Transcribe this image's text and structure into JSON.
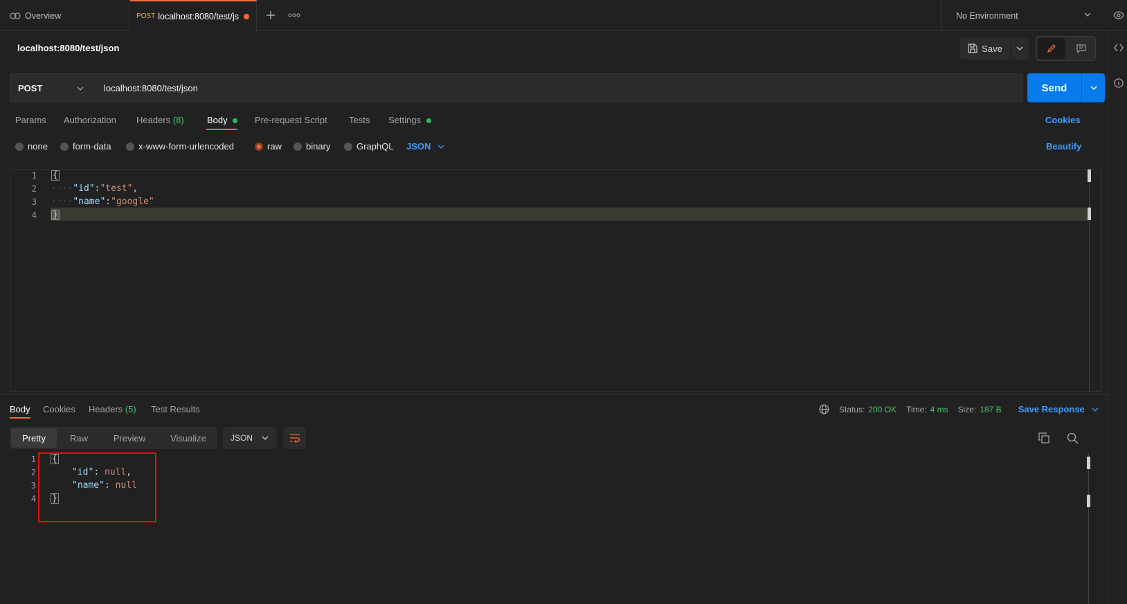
{
  "tabs": {
    "overview_label": "Overview",
    "active_method": "POST",
    "active_label": "localhost:8080/test/js",
    "environment": "No Environment"
  },
  "request": {
    "title": "localhost:8080/test/json",
    "save_label": "Save",
    "method": "POST",
    "url": "localhost:8080/test/json",
    "send_label": "Send"
  },
  "request_tabs": {
    "params": "Params",
    "authorization": "Authorization",
    "headers": "Headers",
    "headers_count": "(8)",
    "body": "Body",
    "pre_request": "Pre-request Script",
    "tests": "Tests",
    "settings": "Settings",
    "cookies": "Cookies"
  },
  "body_options": {
    "none": "none",
    "form_data": "form-data",
    "urlencoded": "x-www-form-urlencoded",
    "raw": "raw",
    "binary": "binary",
    "graphql": "GraphQL",
    "format": "JSON",
    "beautify": "Beautify"
  },
  "request_body": {
    "line_numbers": [
      "1",
      "2",
      "3",
      "4"
    ],
    "open_brace": "{",
    "close_brace": "}",
    "line2_indent": "····",
    "line2_key": "\"id\"",
    "line2_colon": ":",
    "line2_value": "\"test\"",
    "line2_comma": ",",
    "line3_indent": "····",
    "line3_key": "\"name\"",
    "line3_colon": ":",
    "line3_value": "\"google\""
  },
  "response_tabs": {
    "body": "Body",
    "cookies": "Cookies",
    "headers": "Headers",
    "headers_count": "(5)",
    "test_results": "Test Results"
  },
  "response_status": {
    "status_label": "Status:",
    "status_value": "200 OK",
    "time_label": "Time:",
    "time_value": "4 ms",
    "size_label": "Size:",
    "size_value": "187 B",
    "save_response": "Save Response"
  },
  "response_view": {
    "pretty": "Pretty",
    "raw": "Raw",
    "preview": "Preview",
    "visualize": "Visualize",
    "format": "JSON"
  },
  "response_body": {
    "line_numbers": [
      "1",
      "2",
      "3",
      "4"
    ],
    "open_brace": "{",
    "close_brace": "}",
    "line2_key": "\"id\"",
    "line2_sep": ": ",
    "line2_value": "null",
    "line2_comma": ",",
    "line3_key": "\"name\"",
    "line3_sep": ": ",
    "line3_value": "null"
  },
  "colors": {
    "accent_orange": "#f26b3a",
    "send_blue": "#097bed",
    "link_blue": "#3d9cff",
    "success_green": "#49c46f",
    "highlight_red": "#e30f16"
  }
}
